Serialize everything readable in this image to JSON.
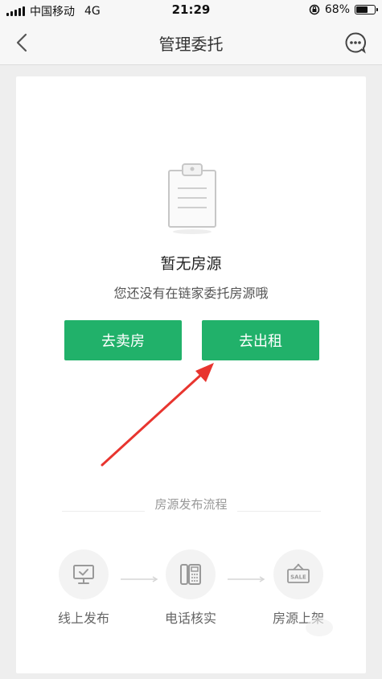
{
  "status_bar": {
    "carrier": "中国移动",
    "network": "4G",
    "time": "21:29",
    "battery": "68%",
    "battery_level": 0.68
  },
  "nav": {
    "title": "管理委托",
    "back_icon": "chevron-left-icon",
    "chat_icon": "chat-bubble-dots-icon"
  },
  "empty_state": {
    "icon": "clipboard-icon",
    "title": "暂无房源",
    "subtitle": "您还没有在链家委托房源哦"
  },
  "actions": {
    "sell_label": "去卖房",
    "rent_label": "去出租"
  },
  "process": {
    "label": "房源发布流程",
    "steps": [
      {
        "label": "线上发布",
        "icon": "monitor-check-icon"
      },
      {
        "label": "电话核实",
        "icon": "phone-icon"
      },
      {
        "label": "房源上架",
        "icon": "sale-sign-icon"
      }
    ]
  },
  "colors": {
    "accent_green": "#21b16a",
    "annotation_red": "#e8352f",
    "background": "#eeeeee"
  }
}
